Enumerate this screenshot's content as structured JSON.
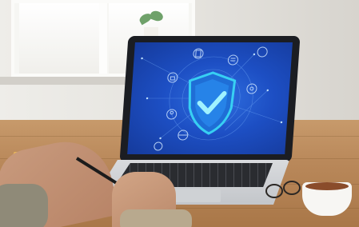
{
  "scene": {
    "screen_theme": "blue",
    "central_icon": "shield-check-icon",
    "orbit_icons": [
      "document-icon",
      "list-icon",
      "cloud-icon",
      "lock-icon",
      "gear-icon",
      "user-icon",
      "globe-icon",
      "chip-icon"
    ]
  },
  "colors": {
    "screen_blue": "#1d4fc4",
    "shield_glow": "#39d6f5",
    "table_wood": "#b9885a",
    "tea": "#8a4c2b"
  }
}
